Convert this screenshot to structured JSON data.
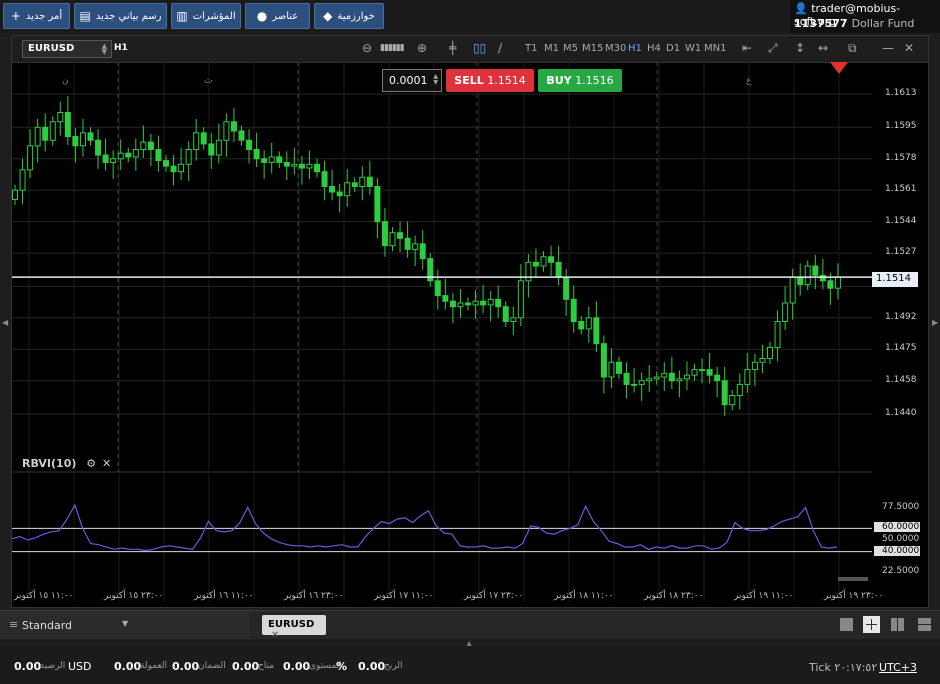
{
  "toolbar": {
    "new_order": "أمر جديد",
    "new_chart": "رسم بياني جديد",
    "indicators": "المؤشرات",
    "elements": "عناصر",
    "algorithm": "خوارزمية"
  },
  "account": {
    "user": "trader@mobius-soft.org",
    "number": "1137577",
    "fund": "Dollar Fund"
  },
  "chart": {
    "symbol": "EURUSD",
    "timeframe_label": "H1",
    "timeframes": [
      "T1",
      "M1",
      "M5",
      "M15",
      "M30",
      "H1",
      "H4",
      "D1",
      "W1",
      "MN1"
    ],
    "active_timeframe": "H1",
    "volume": "0.0001",
    "sell_label": "SELL",
    "sell_price": "1.1514",
    "buy_label": "BUY",
    "buy_price": "1.1516",
    "current_price": "1.1514",
    "price_ticks": [
      "1.1613",
      "1.1595",
      "1.1578",
      "1.1561",
      "1.1544",
      "1.1527",
      "1.1509",
      "1.1492",
      "1.1475",
      "1.1458",
      "1.1440"
    ],
    "day_letters": [
      "ن",
      "ث",
      "ع"
    ],
    "indicator_name": "RBVI(10)",
    "indicator_ticks": [
      "77.5000",
      "60.0000",
      "50.0000",
      "40.0000",
      "22.5000"
    ],
    "x_labels": [
      "١١:٠٠ ١٥ أكتوبر",
      "٢٣:٠٠ ١٥ أكتوبر",
      "١١:٠٠ ١٦ أكتوبر",
      "٢٣:٠٠ ١٦ أكتوبر",
      "١١:٠٠ ١٧ أكتوبر",
      "٢٣:٠٠ ١٧ أكتوبر",
      "١١:٠٠ ١٨ أكتوبر",
      "٢٣:٠٠ ١٨ أكتوبر",
      "١١:٠٠ ١٩ أكتوبر",
      "٢٣:٠٠ ١٩ أكتوبر"
    ]
  },
  "chart_data": {
    "type": "candlestick",
    "price_axis": [
      1.144,
      1.1613
    ],
    "rbvi_axis": [
      22.5,
      77.5
    ],
    "rbvi_levels": [
      60,
      40
    ],
    "close": [
      1.1561,
      1.1572,
      1.1585,
      1.1595,
      1.1588,
      1.1598,
      1.1603,
      1.159,
      1.1585,
      1.1592,
      1.1588,
      1.158,
      1.1576,
      1.1578,
      1.1581,
      1.1579,
      1.1583,
      1.1587,
      1.1583,
      1.1577,
      1.1574,
      1.1571,
      1.1575,
      1.1583,
      1.1592,
      1.1586,
      1.158,
      1.1588,
      1.1598,
      1.1593,
      1.1588,
      1.1583,
      1.1578,
      1.1576,
      1.1579,
      1.1576,
      1.1574,
      1.1575,
      1.1573,
      1.1575,
      1.1571,
      1.1563,
      1.156,
      1.1558,
      1.1565,
      1.1563,
      1.1568,
      1.1563,
      1.1544,
      1.1531,
      1.1538,
      1.1535,
      1.1529,
      1.1532,
      1.1524,
      1.1512,
      1.1504,
      1.1501,
      1.1498,
      1.15,
      1.1499,
      1.1501,
      1.1499,
      1.1502,
      1.1498,
      1.149,
      1.1492,
      1.1512,
      1.1522,
      1.152,
      1.1525,
      1.1522,
      1.1514,
      1.1502,
      1.149,
      1.1486,
      1.1492,
      1.1478,
      1.146,
      1.1468,
      1.1462,
      1.1456,
      1.1456,
      1.1458,
      1.1459,
      1.146,
      1.1462,
      1.1458,
      1.1459,
      1.1461,
      1.1464,
      1.1464,
      1.1461,
      1.1458,
      1.1445,
      1.145,
      1.1456,
      1.1464,
      1.1468,
      1.147,
      1.1476,
      1.149,
      1.15,
      1.1514,
      1.151,
      1.152,
      1.1515,
      1.1512,
      1.1508,
      1.1514
    ],
    "rbvi": [
      51,
      53,
      50,
      52,
      55,
      57,
      58,
      68,
      80,
      60,
      47,
      46,
      44,
      42,
      43,
      42,
      42,
      41,
      42,
      44,
      45,
      44,
      43,
      42,
      52,
      66,
      58,
      57,
      58,
      65,
      78,
      64,
      56,
      51,
      48,
      46,
      45,
      45,
      44,
      45,
      44,
      45,
      46,
      44,
      44,
      53,
      60,
      66,
      64,
      68,
      69,
      65,
      71,
      75,
      62,
      56,
      55,
      45,
      44,
      44,
      45,
      43,
      43,
      44,
      43,
      47,
      62,
      61,
      56,
      55,
      58,
      60,
      63,
      79,
      66,
      58,
      49,
      47,
      44,
      44,
      46,
      42,
      44,
      43,
      45,
      43,
      43,
      45,
      45,
      42,
      43,
      48,
      65,
      60,
      58,
      58,
      59,
      62,
      66,
      68,
      70,
      78,
      58,
      44,
      43,
      44
    ]
  }
}
